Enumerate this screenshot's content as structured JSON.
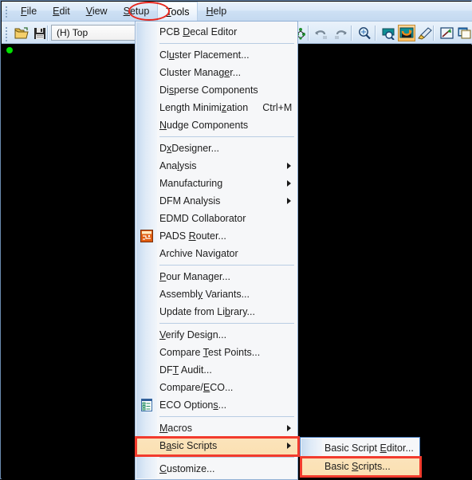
{
  "app": {
    "canvas_origin_marker": "origin-dot"
  },
  "menubar": {
    "items": [
      {
        "label": "File",
        "accel": "F",
        "name": "menubar-item-file"
      },
      {
        "label": "Edit",
        "accel": "E",
        "name": "menubar-item-edit"
      },
      {
        "label": "View",
        "accel": "V",
        "name": "menubar-item-view"
      },
      {
        "label": "Setup",
        "accel": "S",
        "name": "menubar-item-setup"
      },
      {
        "label": "Tools",
        "accel": "T",
        "name": "menubar-item-tools",
        "active": true
      },
      {
        "label": "Help",
        "accel": "H",
        "name": "menubar-item-help"
      }
    ]
  },
  "toolbar": {
    "layer_value": "(H) Top",
    "buttons": [
      {
        "name": "open-icon",
        "title": "Open"
      },
      {
        "name": "save-icon",
        "title": "Save"
      },
      {
        "name": "design-rules-icon",
        "title": "Design Rules"
      },
      {
        "name": "undo-icon",
        "title": "Undo"
      },
      {
        "name": "redo-icon",
        "title": "Redo"
      },
      {
        "name": "zoom-icon",
        "title": "Zoom"
      },
      {
        "name": "view-search-icon",
        "title": "Search"
      },
      {
        "name": "pour-icon",
        "title": "Flood",
        "pressed": true
      },
      {
        "name": "brush-icon",
        "title": "Highlight"
      },
      {
        "name": "arrow-window-icon",
        "title": "Open Window"
      },
      {
        "name": "copy-window-icon",
        "title": "Copy to Clipboard"
      }
    ]
  },
  "tools_menu": {
    "highlight_color": "#f23b2d",
    "items": [
      {
        "type": "item",
        "label": "PCB Decal Editor",
        "accel_index": 4,
        "name": "menu-item-pcb-decal-editor"
      },
      {
        "type": "sep"
      },
      {
        "type": "item",
        "label": "Cluster Placement...",
        "accel_index": 2,
        "name": "menu-item-cluster-placement"
      },
      {
        "type": "item",
        "label": "Cluster Manager...",
        "accel_index": 13,
        "name": "menu-item-cluster-manager"
      },
      {
        "type": "item",
        "label": "Disperse Components",
        "accel_index": 2,
        "name": "menu-item-disperse-components"
      },
      {
        "type": "item",
        "label": "Length Minimization",
        "accel_index": 13,
        "shortcut": "Ctrl+M",
        "name": "menu-item-length-minimization"
      },
      {
        "type": "item",
        "label": "Nudge Components",
        "accel_index": 0,
        "name": "menu-item-nudge-components"
      },
      {
        "type": "sep"
      },
      {
        "type": "item",
        "label": "DxDesigner...",
        "accel_index": 1,
        "name": "menu-item-dxdesigner"
      },
      {
        "type": "item",
        "label": "Analysis",
        "accel_index": 3,
        "arrow": true,
        "name": "menu-item-analysis"
      },
      {
        "type": "item",
        "label": "Manufacturing",
        "arrow": true,
        "name": "menu-item-manufacturing"
      },
      {
        "type": "item",
        "label": "DFM Analysis",
        "arrow": true,
        "name": "menu-item-dfm-analysis"
      },
      {
        "type": "item",
        "label": "EDMD Collaborator",
        "name": "menu-item-edmd-collaborator"
      },
      {
        "type": "item",
        "label": "PADS Router...",
        "accel_index": 5,
        "icon": "pads-router-icon",
        "name": "menu-item-pads-router"
      },
      {
        "type": "item",
        "label": "Archive Navigator",
        "accel_index": 12,
        "name": "menu-item-archive-navigator"
      },
      {
        "type": "sep"
      },
      {
        "type": "item",
        "label": "Pour Manager...",
        "accel_index": 0,
        "name": "menu-item-pour-manager"
      },
      {
        "type": "item",
        "label": "Assembly Variants...",
        "accel_index": 7,
        "name": "menu-item-assembly-variants"
      },
      {
        "type": "item",
        "label": "Update from Library...",
        "accel_index": 14,
        "name": "menu-item-update-from-library"
      },
      {
        "type": "sep"
      },
      {
        "type": "item",
        "label": "Verify Design...",
        "accel_index": 0,
        "name": "menu-item-verify-design"
      },
      {
        "type": "item",
        "label": "Compare Test Points...",
        "accel_index": 8,
        "name": "menu-item-compare-test-points"
      },
      {
        "type": "item",
        "label": "DFT Audit...",
        "accel_index": 2,
        "name": "menu-item-dft-audit"
      },
      {
        "type": "item",
        "label": "Compare/ECO...",
        "accel_index": 8,
        "name": "menu-item-compare-eco"
      },
      {
        "type": "item",
        "label": "ECO Options...",
        "accel_index": 10,
        "icon": "eco-options-icon",
        "name": "menu-item-eco-options"
      },
      {
        "type": "sep"
      },
      {
        "type": "item",
        "label": "Macros",
        "accel_index": 0,
        "arrow": true,
        "name": "menu-item-macros"
      },
      {
        "type": "item",
        "label": "Basic Scripts",
        "accel_index": 1,
        "arrow": true,
        "highlighted": true,
        "boxed": true,
        "name": "menu-item-basic-scripts"
      },
      {
        "type": "sep"
      },
      {
        "type": "item",
        "label": "Customize...",
        "accel_index": 0,
        "name": "menu-item-customize"
      }
    ]
  },
  "basic_scripts_submenu": {
    "items": [
      {
        "label": "Basic Script Editor...",
        "accel_index": 13,
        "name": "submenu-item-basic-script-editor"
      },
      {
        "label": "Basic Scripts...",
        "accel_index": 6,
        "highlighted": true,
        "boxed": true,
        "name": "submenu-item-basic-scripts"
      }
    ]
  }
}
